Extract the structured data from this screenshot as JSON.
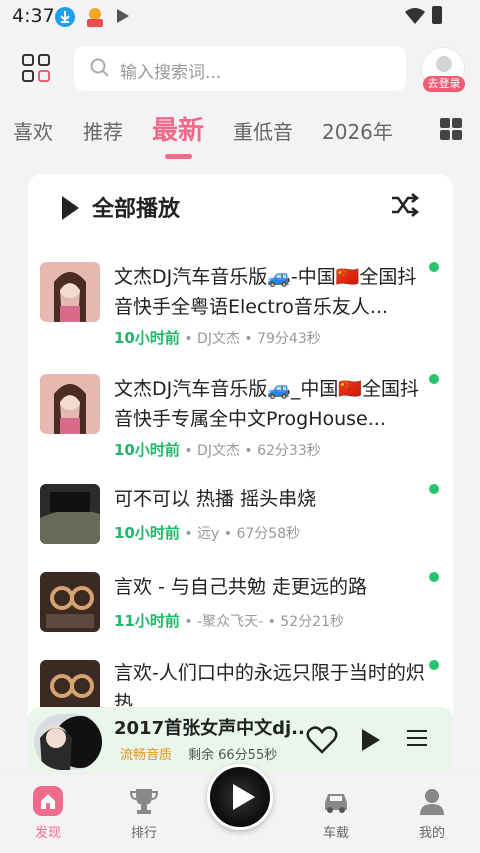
{
  "status_bar": {
    "time": "4:37",
    "icons": [
      "download-icon",
      "app-icon",
      "play-icon",
      "wifi-icon",
      "battery-icon"
    ]
  },
  "header": {
    "search_placeholder": "输入搜索词...",
    "login_badge": "去登录"
  },
  "tabs": [
    {
      "label": "喜欢",
      "active": false
    },
    {
      "label": "推荐",
      "active": false
    },
    {
      "label": "最新",
      "active": true
    },
    {
      "label": "重低音",
      "active": false
    },
    {
      "label": "2026年",
      "active": false
    }
  ],
  "play_all_label": "全部播放",
  "songs": [
    {
      "title": "文杰DJ汽车音乐版🚙-中国🇨🇳全国抖音快手全粤语Electro音乐友人...",
      "time": "10小时前",
      "meta": "• DJ文杰 • 79分43秒"
    },
    {
      "title": "文杰DJ汽车音乐版🚙_中国🇨🇳全国抖音快手专属全中文ProgHouse...",
      "time": "10小时前",
      "meta": "• DJ文杰 • 62分33秒"
    },
    {
      "title": "可不可以 热播 摇头串烧",
      "time": "10小时前",
      "meta": "• 远y • 67分58秒"
    },
    {
      "title": "言欢 - 与自己共勉 走更远的路",
      "time": "11小时前",
      "meta": "• -聚众飞天- • 52分21秒"
    },
    {
      "title": "言欢-人们口中的永远只限于当时的炽热",
      "time": "",
      "meta": ""
    }
  ],
  "mini_player": {
    "title": "2017首张女声中文dj...",
    "quality": "流畅音质",
    "remaining": "剩余 66分55秒"
  },
  "bottom_nav": [
    {
      "label": "发现",
      "icon": "home-icon",
      "active": true
    },
    {
      "label": "排行",
      "icon": "trophy-icon",
      "active": false
    },
    {
      "label": "车载",
      "icon": "car-icon",
      "active": false
    },
    {
      "label": "我的",
      "icon": "user-icon",
      "active": false
    }
  ],
  "colors": {
    "accent": "#f06a8a",
    "time_green": "#21b86a",
    "dot_green": "#2bc26d",
    "quality_orange": "#e4941b"
  }
}
